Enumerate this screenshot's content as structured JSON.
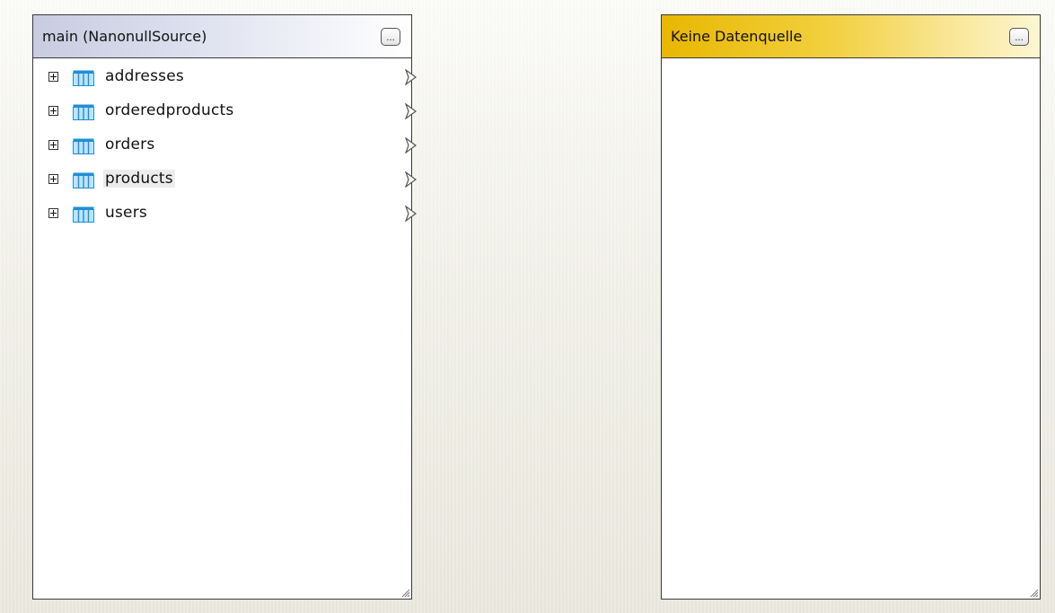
{
  "left_component": {
    "title": "main (NanonullSource)",
    "menu_button_label": "...",
    "items": [
      {
        "label": "addresses"
      },
      {
        "label": "orderedproducts"
      },
      {
        "label": "orders"
      },
      {
        "label": "products"
      },
      {
        "label": "users"
      }
    ]
  },
  "right_component": {
    "title": "Keine Datenquelle",
    "menu_button_label": "..."
  },
  "colors": {
    "left_header_accent": "#c9cce0",
    "right_header_accent": "#e8b700",
    "table_icon": "#1e8fd6"
  },
  "icons": {
    "expander": "plus-box-icon",
    "table": "table-icon",
    "connector": "output-connector-icon",
    "menu": "ellipsis-button-icon",
    "grip": "resize-grip-icon"
  }
}
